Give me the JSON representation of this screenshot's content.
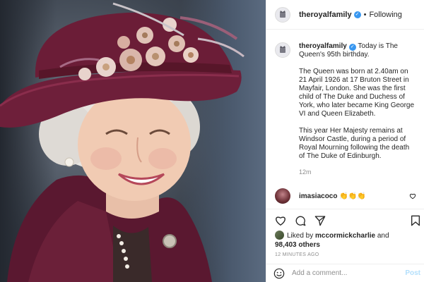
{
  "header": {
    "username": "theroyalfamily",
    "separator": "•",
    "follow_label": "Following"
  },
  "caption": {
    "username": "theroyalfamily",
    "first_line": "Today is The Queen's 95th birthday.",
    "paragraph_2": "The Queen was born at 2.40am on 21 April 1926 at 17 Bruton Street in Mayfair, London. She was the first child of The Duke and Duchess of York, who later became King George VI and Queen Elizabeth.",
    "paragraph_3": "This year Her Majesty remains at Windsor Castle, during a period of Royal Mourning following the death of The Duke of Edinburgh.",
    "time": "12m"
  },
  "comment": {
    "username": "imasiacoco",
    "text": "👏👏👏"
  },
  "likes": {
    "prefix": "Liked by",
    "user": "mccormickcharlie",
    "and": "and",
    "count": "98,403 others"
  },
  "timeago": "12 MINUTES AGO",
  "add_comment": {
    "placeholder": "Add a comment...",
    "post_label": "Post"
  },
  "colors": {
    "verified": "#3897f0",
    "hat": "#6e1f3a",
    "post_disabled": "#b2dffc"
  },
  "icons": [
    "royal-crest-icon",
    "verified-icon",
    "heart-icon",
    "comment-icon",
    "share-icon",
    "bookmark-icon",
    "emoji-icon"
  ]
}
